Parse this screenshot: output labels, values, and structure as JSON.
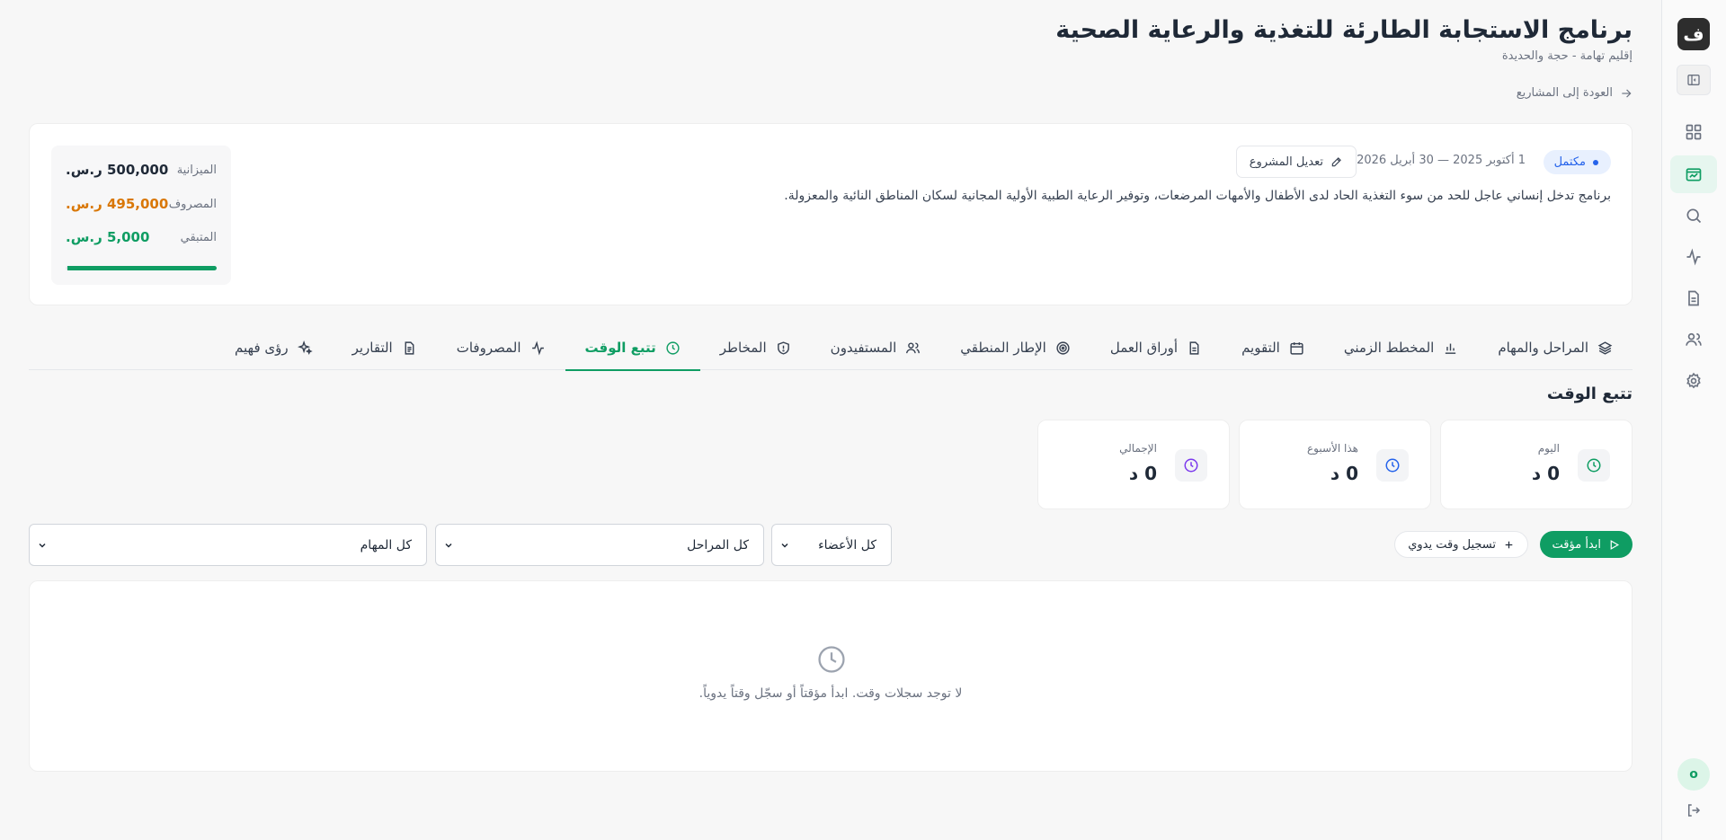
{
  "sidebar": {
    "logo_text": "ف",
    "nav_items": [
      {
        "icon": "grid-icon",
        "active": false
      },
      {
        "icon": "projects-icon",
        "active": true
      },
      {
        "icon": "search-icon",
        "active": false
      },
      {
        "icon": "activity-icon",
        "active": false
      },
      {
        "icon": "document-icon",
        "active": false
      },
      {
        "icon": "users-icon",
        "active": false
      },
      {
        "icon": "settings-icon",
        "active": false
      }
    ],
    "avatar_initial": "o"
  },
  "header": {
    "title": "برنامج الاستجابة الطارئة للتغذية والرعاية الصحية",
    "subtitle": "إقليم تهامة - حجة والحديدة",
    "back_link": "العودة إلى المشاريع"
  },
  "project": {
    "status": "مكتمل",
    "date_range": "1 أكتوبر 2025 — 30 أبريل 2026",
    "edit_label": "تعديل المشروع",
    "description": "برنامج تدخل إنساني عاجل للحد من سوء التغذية الحاد لدى الأطفال والأمهات المرضعات، وتوفير الرعاية الطبية الأولية المجانية لسكان المناطق النائية والمعزولة.",
    "budget": {
      "budget_label": "الميزانية",
      "budget_value": "500,000 ر.س.",
      "spent_label": "المصروف",
      "spent_value": "495,000 ر.س.",
      "remaining_label": "المتبقي",
      "remaining_value": "5,000 ر.س.",
      "spent_fraction": 0.99
    }
  },
  "tabs": [
    {
      "label": "المراحل والمهام",
      "icon": "layers-icon",
      "active": false
    },
    {
      "label": "المخطط الزمني",
      "icon": "bar-chart-icon",
      "active": false
    },
    {
      "label": "التقويم",
      "icon": "calendar-icon",
      "active": false
    },
    {
      "label": "أوراق العمل",
      "icon": "file-icon",
      "active": false
    },
    {
      "label": "الإطار المنطقي",
      "icon": "target-icon",
      "active": false
    },
    {
      "label": "المستفيدون",
      "icon": "users-icon",
      "active": false
    },
    {
      "label": "المخاطر",
      "icon": "shield-icon",
      "active": false
    },
    {
      "label": "تتبع الوقت",
      "icon": "clock-icon",
      "active": true
    },
    {
      "label": "المصروفات",
      "icon": "activity-icon",
      "active": false
    },
    {
      "label": "التقارير",
      "icon": "report-icon",
      "active": false
    },
    {
      "label": "رؤى فهيم",
      "icon": "sparkles-icon",
      "active": false
    }
  ],
  "time_tracking": {
    "title": "تتبع الوقت",
    "stats": [
      {
        "label": "اليوم",
        "value": "0 د",
        "color": "#0f9d63"
      },
      {
        "label": "هذا الأسبوع",
        "value": "0 د",
        "color": "#2563eb"
      },
      {
        "label": "الإجمالي",
        "value": "0 د",
        "color": "#7c3aed"
      }
    ],
    "start_timer_label": "ابدأ مؤقت",
    "manual_entry_label": "تسجيل وقت يدوي",
    "filters": {
      "members": "كل الأعضاء",
      "phases": "كل المراحل",
      "tasks": "كل المهام"
    },
    "empty_message": "لا توجد سجلات وقت. ابدأ مؤقتاً أو سجّل وقتاً يدوياً."
  },
  "colors": {
    "accent": "#0f9d63",
    "spent": "#d97706",
    "remaining": "#0f9d63",
    "status_blue": "#2563eb"
  }
}
